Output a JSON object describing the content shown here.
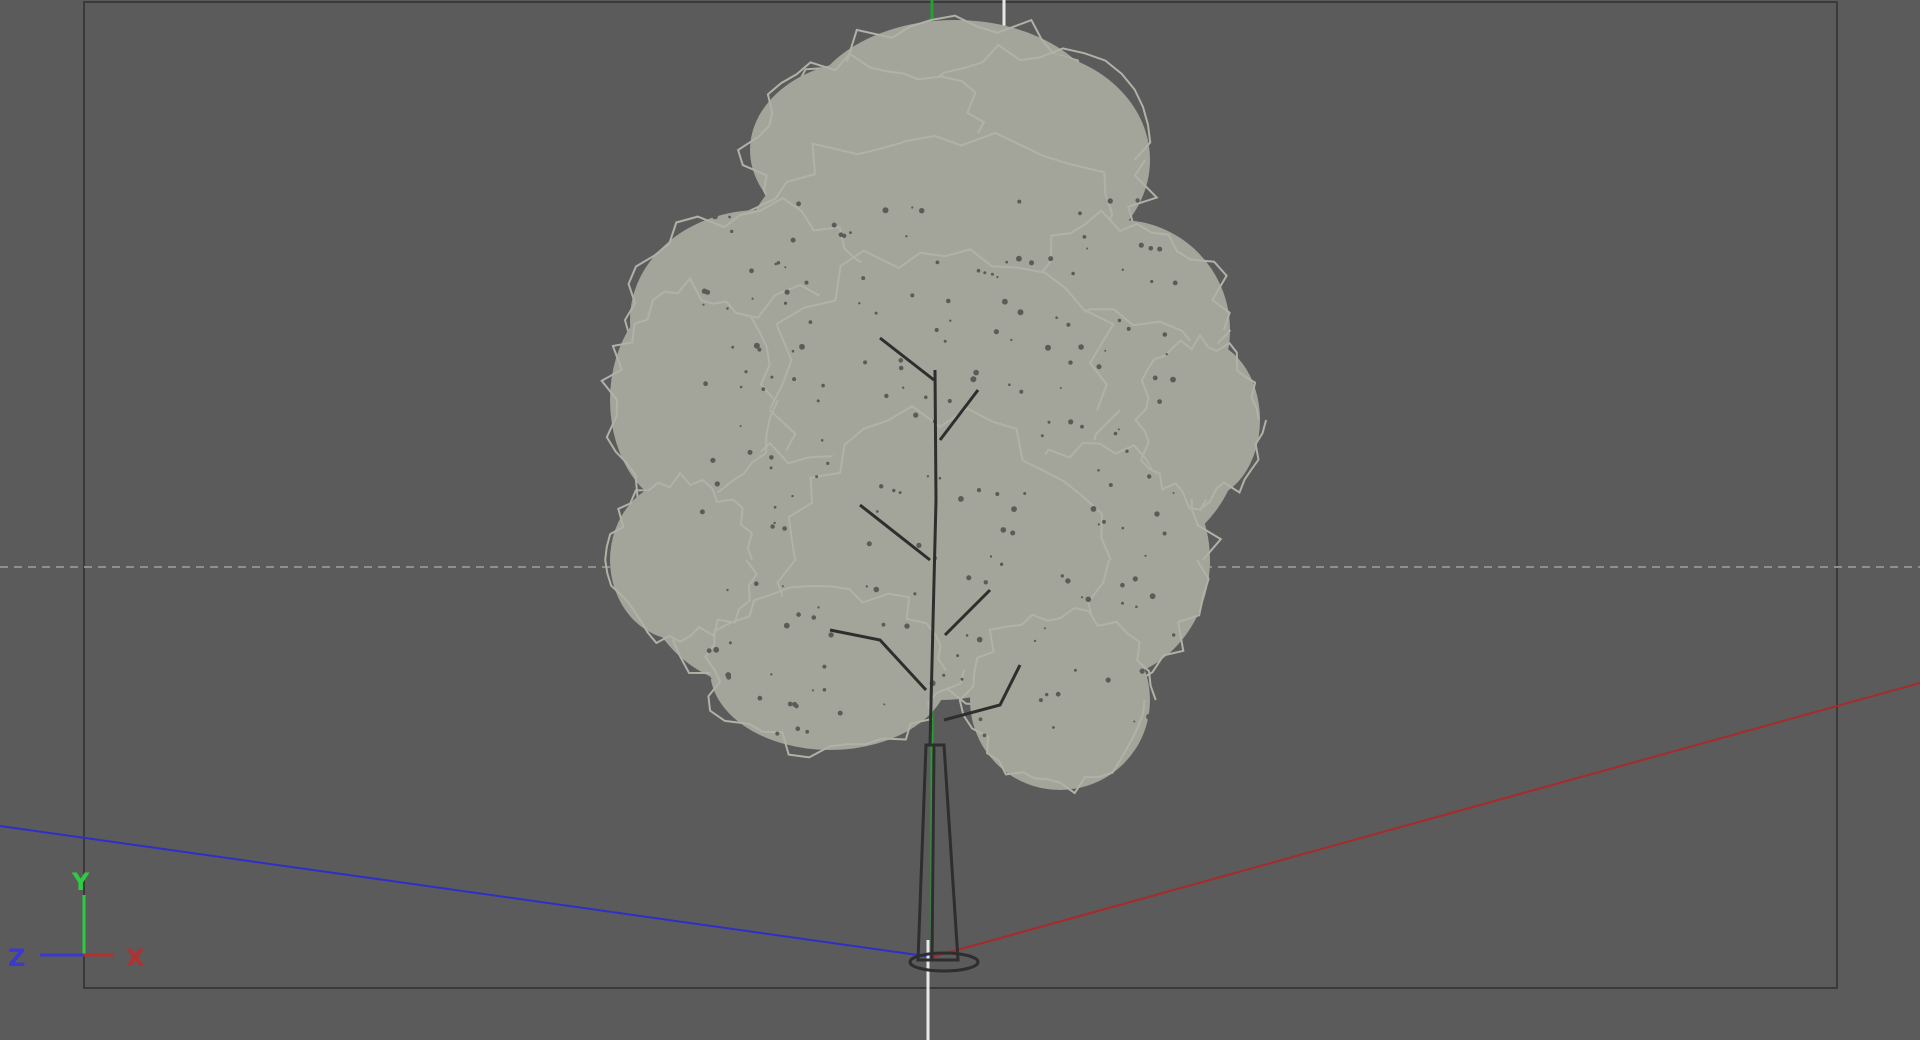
{
  "viewport": {
    "view_mode": "front-wireframe",
    "background_color": "#5b5b5b",
    "object": "tree"
  },
  "axes_gizmo": {
    "y_label": "Y",
    "z_label": "Z",
    "x_label": "X",
    "colors": {
      "x": "#b33030",
      "y": "#2ecc40",
      "z": "#3a3ad0"
    }
  },
  "colors": {
    "frame": "#3a3a3a",
    "foliage": "#a3a59a",
    "trunk": "#2e2e2e",
    "grid_line": "#8f8f8f"
  }
}
